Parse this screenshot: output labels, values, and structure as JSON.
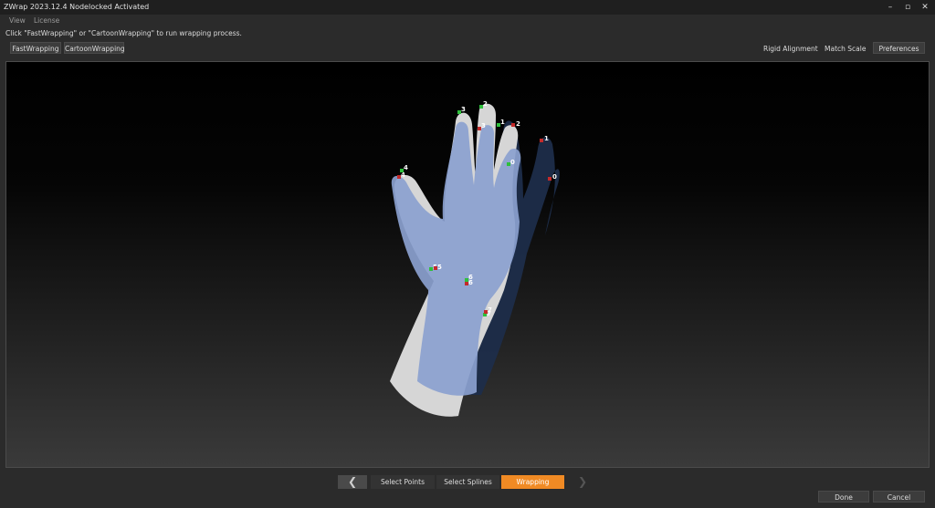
{
  "window": {
    "title": "ZWrap 2023.12.4  Nodelocked Activated",
    "minimize": "–",
    "restore": "▫",
    "close": "✕"
  },
  "menu": [
    "View",
    "License"
  ],
  "hint": "Click \"FastWrapping\" or \"CartoonWrapping\" to run wrapping process.",
  "toolbar": {
    "fast_wrapping": "FastWrapping",
    "cartoon_wrapping": "CartoonWrapping",
    "rigid_alignment": "Rigid Alignment",
    "match_scale": "Match Scale",
    "preferences": "Preferences"
  },
  "viewport": {
    "green_points": [
      "0",
      "1",
      "2",
      "3",
      "4",
      "5",
      "6",
      "7"
    ],
    "red_points": [
      "0",
      "1",
      "2",
      "3",
      "4",
      "5",
      "6",
      "7"
    ]
  },
  "steps": {
    "prev": "❮",
    "next": "❯",
    "items": [
      "Select Points",
      "Select Splines",
      "Wrapping"
    ],
    "active": "Wrapping"
  },
  "actions": {
    "done": "Done",
    "cancel": "Cancel"
  },
  "colors": {
    "accent": "#f08a24",
    "mesh_blue": "#7f93bf",
    "mesh_dark": "#2a3c5e",
    "mesh_white": "#dcdcdc"
  }
}
